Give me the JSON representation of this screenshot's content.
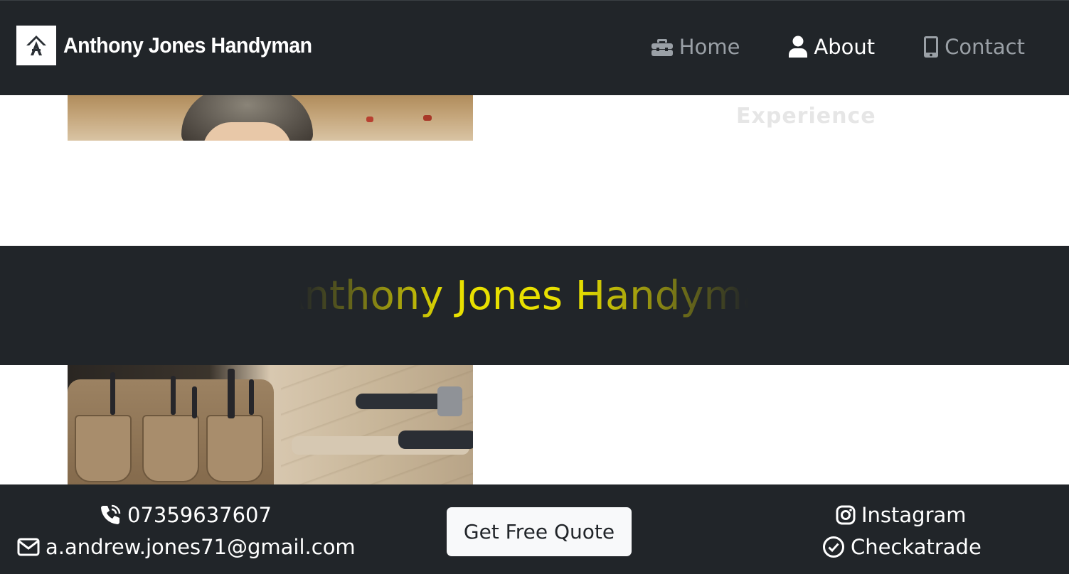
{
  "header": {
    "brand_name": "Anthony Jones Handyman",
    "nav": [
      {
        "label": "Home",
        "icon": "toolbox-icon"
      },
      {
        "label": "About",
        "icon": "user-icon"
      },
      {
        "label": "Contact",
        "icon": "mobile-icon"
      }
    ],
    "active_nav": "About"
  },
  "main": {
    "faded_heading": "Experience",
    "marquee_text": "Anthony Jones Handyman"
  },
  "footer": {
    "phone": "07359637607",
    "email": "a.andrew.jones71@gmail.com",
    "quote_button": "Get Free Quote",
    "instagram": "Instagram",
    "checkatrade": "Checkatrade"
  },
  "colors": {
    "dark": "#212529",
    "accent_yellow": "#e8e000",
    "nav_muted": "#9aa0a6"
  }
}
